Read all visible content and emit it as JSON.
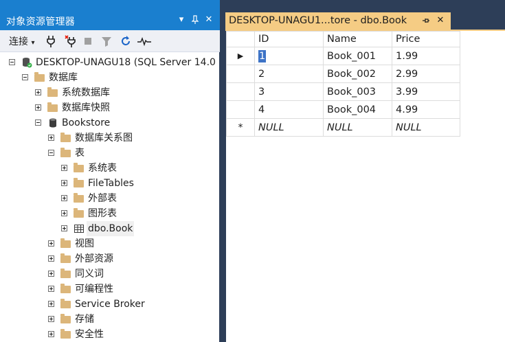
{
  "explorer": {
    "title": "对象资源管理器",
    "connect_label": "连接",
    "connect_arrow": "▾",
    "title_buttons": {
      "dropdown": "▾",
      "pin": "⊣",
      "close": "✕"
    }
  },
  "tree": {
    "server": "DESKTOP-UNAGU18 (SQL Server 14.0",
    "databases": "数据库",
    "system_databases": "系统数据库",
    "database_snapshots": "数据库快照",
    "bookstore": "Bookstore",
    "db_diagrams": "数据库关系图",
    "tables": "表",
    "system_tables": "系统表",
    "file_tables": "FileTables",
    "external_tables": "外部表",
    "graph_tables": "图形表",
    "dbo_book": "dbo.Book",
    "views": "视图",
    "external_resources": "外部资源",
    "synonyms": "同义词",
    "programmability": "可编程性",
    "service_broker": "Service Broker",
    "storage": "存储",
    "security": "安全性"
  },
  "document_tab": {
    "title": "DESKTOP-UNAGU1...tore - dbo.Book",
    "pin": "⊣",
    "close": "✕"
  },
  "grid": {
    "columns": [
      "ID",
      "Name",
      "Price"
    ],
    "rows": [
      {
        "id": "1",
        "name": "Book_001",
        "price": "1.99",
        "marker": "▶"
      },
      {
        "id": "2",
        "name": "Book_002",
        "price": "2.99",
        "marker": ""
      },
      {
        "id": "3",
        "name": "Book_003",
        "price": "3.99",
        "marker": ""
      },
      {
        "id": "4",
        "name": "Book_004",
        "price": "4.99",
        "marker": ""
      }
    ],
    "new_row": {
      "marker": "*",
      "id": "NULL",
      "name": "NULL",
      "price": "NULL"
    }
  },
  "colors": {
    "title_bar": "#1a7fcf",
    "background": "#2d3e58",
    "active_tab": "#f5cc84",
    "selection": "#3d73c6",
    "folder": "#dcb67a"
  }
}
